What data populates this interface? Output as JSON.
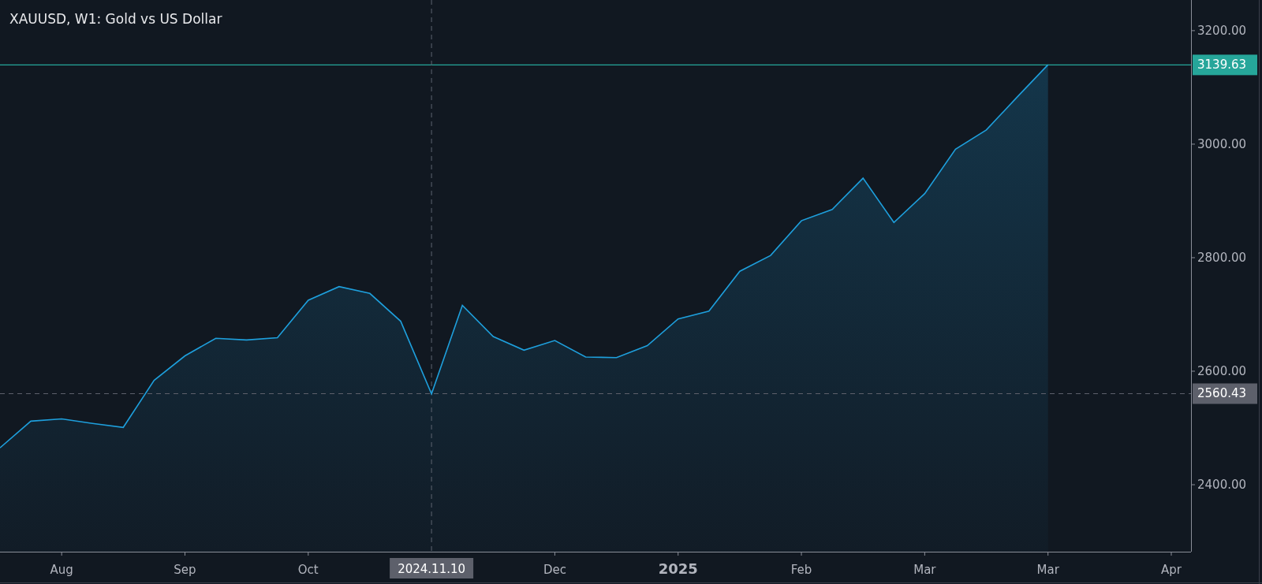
{
  "chart": {
    "title": "XAUUSD, W1: Gold vs US Dollar",
    "chart_data": {
      "type": "area",
      "categories": [
        null,
        null,
        "Aug",
        null,
        null,
        null,
        "Sep",
        null,
        null,
        null,
        "Oct",
        null,
        null,
        null,
        "2024.11.10",
        null,
        null,
        null,
        "Dec",
        null,
        null,
        null,
        "2025",
        null,
        null,
        null,
        "Feb",
        null,
        null,
        null,
        "Mar",
        null,
        null,
        null,
        "Mar",
        null,
        null,
        null,
        "Apr"
      ],
      "series": [
        {
          "color": "#1e9fdc",
          "values": [
            2465,
            2512,
            2516,
            2508,
            2501,
            2584,
            2627,
            2658,
            2655,
            2659,
            2725,
            2749,
            2737,
            2688,
            2560,
            2716,
            2661,
            2637,
            2654,
            2625,
            2624,
            2645,
            2692,
            2706,
            2776,
            2804,
            2865,
            2885,
            2940,
            2862,
            2913,
            2991,
            3025,
            3083,
            3140,
            null,
            null,
            null,
            null
          ]
        }
      ],
      "ylim": [
        2282,
        3254
      ],
      "yticks": [
        {
          "value": 2400,
          "label": "2400.00"
        },
        {
          "value": 2600,
          "label": "2600.00"
        },
        {
          "value": 2800,
          "label": "2800.00"
        },
        {
          "value": 3000,
          "label": "3000.00"
        },
        {
          "value": 3200,
          "label": "3200.00"
        }
      ],
      "ref_lines": [
        {
          "axis": "y",
          "value": 3139.63,
          "label": "3139.63",
          "color": "#26a69a"
        },
        {
          "axis": "y",
          "value": 2560.43,
          "label": "2560.43",
          "color": "#5d606b"
        },
        {
          "axis": "x",
          "value": "2024.11.10",
          "color": "#5d606b"
        }
      ]
    }
  }
}
